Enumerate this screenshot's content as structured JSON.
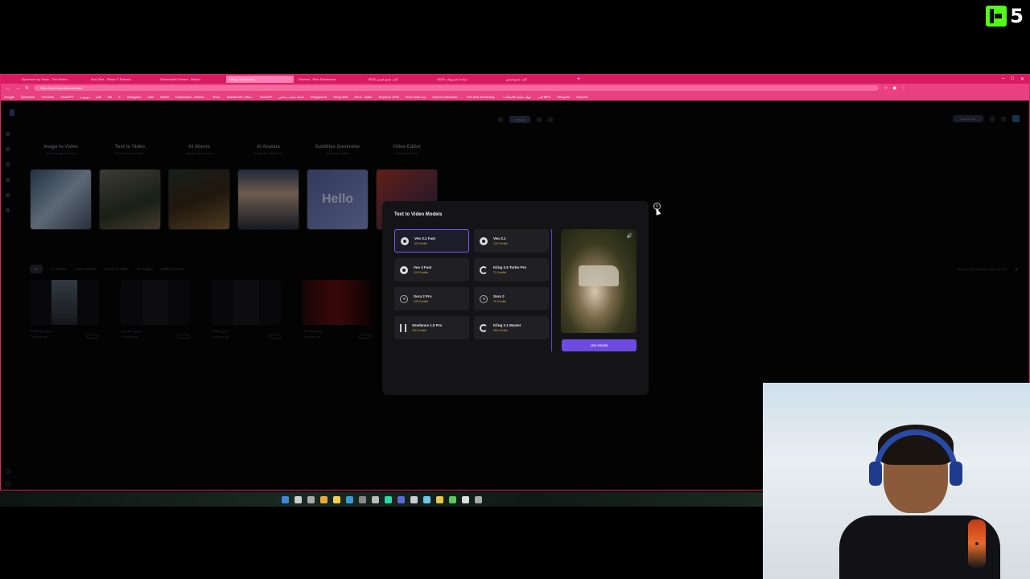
{
  "stream_logo": {
    "badge": "K",
    "number": "5",
    "brand_color": "#53fc18"
  },
  "browser": {
    "tabs": [
      {
        "label": "Speedrun by Onda - The Online..."
      },
      {
        "label": "Kira Ölak - Rihan Ti Pahssa..."
      },
      {
        "label": "SabamokiAI Dream - Watch..."
      },
      {
        "label": "Kling | Dashboard",
        "active": true
      },
      {
        "label": "Seream - Rich Dashboard"
      },
      {
        "label": "كيف تصنع فيديو بالذكاء"
      },
      {
        "label": "صناعة فيديوهات الذكاء"
      },
      {
        "label": "كيف تصنع فيديو"
      }
    ],
    "url": "https://dashboard/studio/main",
    "bookmarks": [
      "Google",
      "Speedrun",
      "YouTube",
      "ChatGPT",
      "يوتيوب",
      "فلام",
      "Kill",
      "X",
      "Instagram",
      "mdx",
      "Netflix",
      "Dashboard - Restre...",
      "Envo",
      "Dashboard / Stra...",
      "SolutOP",
      "انشاء حساب ماتش",
      "Playground",
      "Temp Mail",
      "Sora - Video",
      "Replicon CFM",
      "Sora Vods (ما)",
      "Discord Streamer...",
      "The best streaming...",
      "مولد سابقة للاسكتات",
      "قمر MP4",
      "Telegram",
      "Discord"
    ]
  },
  "app": {
    "top_center_pill": "AI Studio",
    "upgrade_label": "Upgrade Plan",
    "tools": [
      {
        "title": "Image to Video",
        "subtitle": "Turn an Image to a Video"
      },
      {
        "title": "Text to Video",
        "subtitle": "Turn an Idea to a Video"
      },
      {
        "title": "AI Shorts",
        "subtitle": "Videos ready to share"
      },
      {
        "title": "AI Avatars",
        "subtitle": "Create your Digital Twin"
      },
      {
        "title": "Subtitles Generator",
        "subtitle": "Speech to subtitles",
        "thumb_text": "Hello"
      },
      {
        "title": "Video Editor",
        "subtitle": "Easy video editing"
      }
    ],
    "filters": [
      "All",
      "AI Videos",
      "Avatar Videos",
      "Quote to Video",
      "AI Images",
      "Edited Videos"
    ],
    "sort_label": "Sort by: Date Created (New to Old)",
    "gallery": [
      {
        "title": "فيديو ذكي بالذكاء",
        "time": "3 minutes ago"
      },
      {
        "title": "فيديو ذكاء جديد",
        "time": "4 minutes ago"
      },
      {
        "title": "فيديو بالذكاء",
        "time": "5 minutes ago"
      },
      {
        "title": "فيديو ذكاء ذكي",
        "time": "7 minutes ago"
      }
    ]
  },
  "modal": {
    "title": "Text to Video Models",
    "models": [
      {
        "name": "Veo 3.1 Fast",
        "credits": "60 Credits",
        "icon": "veo-icon",
        "selected": true
      },
      {
        "name": "Veo 3.1",
        "credits": "120 Credits",
        "icon": "veo-icon"
      },
      {
        "name": "Veo 3 Fast",
        "credits": "100 Credits",
        "icon": "veo-icon"
      },
      {
        "name": "Kling 2.5 Turbo Pro",
        "credits": "70 Credits",
        "icon": "kling-icon"
      },
      {
        "name": "Sora 2 Pro",
        "credits": "225 Credits",
        "icon": "sora-icon"
      },
      {
        "name": "Sora 2",
        "credits": "75 Credits",
        "icon": "sora-icon"
      },
      {
        "name": "Seedance 1.0 Pro",
        "credits": "250 Credits",
        "icon": "seedance-icon"
      },
      {
        "name": "Kling 2.1 Master",
        "credits": "450 Credits",
        "icon": "kling-icon"
      }
    ],
    "use_button": "Use Model",
    "accent_color": "#6d4ae0",
    "credits_color": "#e2b33c"
  }
}
